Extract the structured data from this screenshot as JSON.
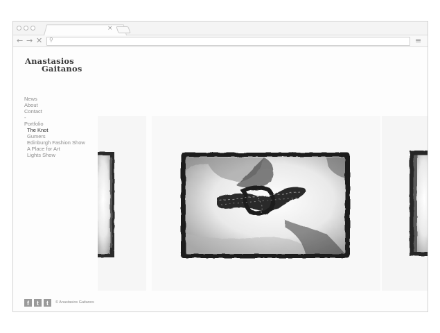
{
  "browser": {
    "tab_close": "×",
    "back": "←",
    "forward": "→",
    "stop": "✕",
    "search_glyph": "⚲",
    "menu": "≡"
  },
  "site": {
    "logo_line1": "Anastasios",
    "logo_line2": "Gaitanos"
  },
  "nav": {
    "news": "News",
    "about": "About",
    "contact": "Contact",
    "separator": "-",
    "portfolio": "Portfolio",
    "projects": [
      "The Knot",
      "Gumers",
      "Edinburgh Fashion Show",
      "A Place for Art",
      "Lights Show"
    ],
    "active_project": "The Knot"
  },
  "footer": {
    "social_icons": [
      "facebook-icon",
      "twitter-icon",
      "tumblr-icon"
    ],
    "facebook_glyph": "f",
    "twitter_glyph": "t",
    "tumblr_glyph": "t",
    "copyright": "© Anastasios Gaitanos"
  },
  "gallery": {
    "project": "The Knot",
    "images": [
      "rope-knot-plate-left-partial",
      "rope-knot-plate-center",
      "rope-knot-plate-right-partial"
    ]
  },
  "colors": {
    "text": "#8c8c8c",
    "active": "#2b2b2b",
    "social_bg": "#9a9a9a"
  }
}
